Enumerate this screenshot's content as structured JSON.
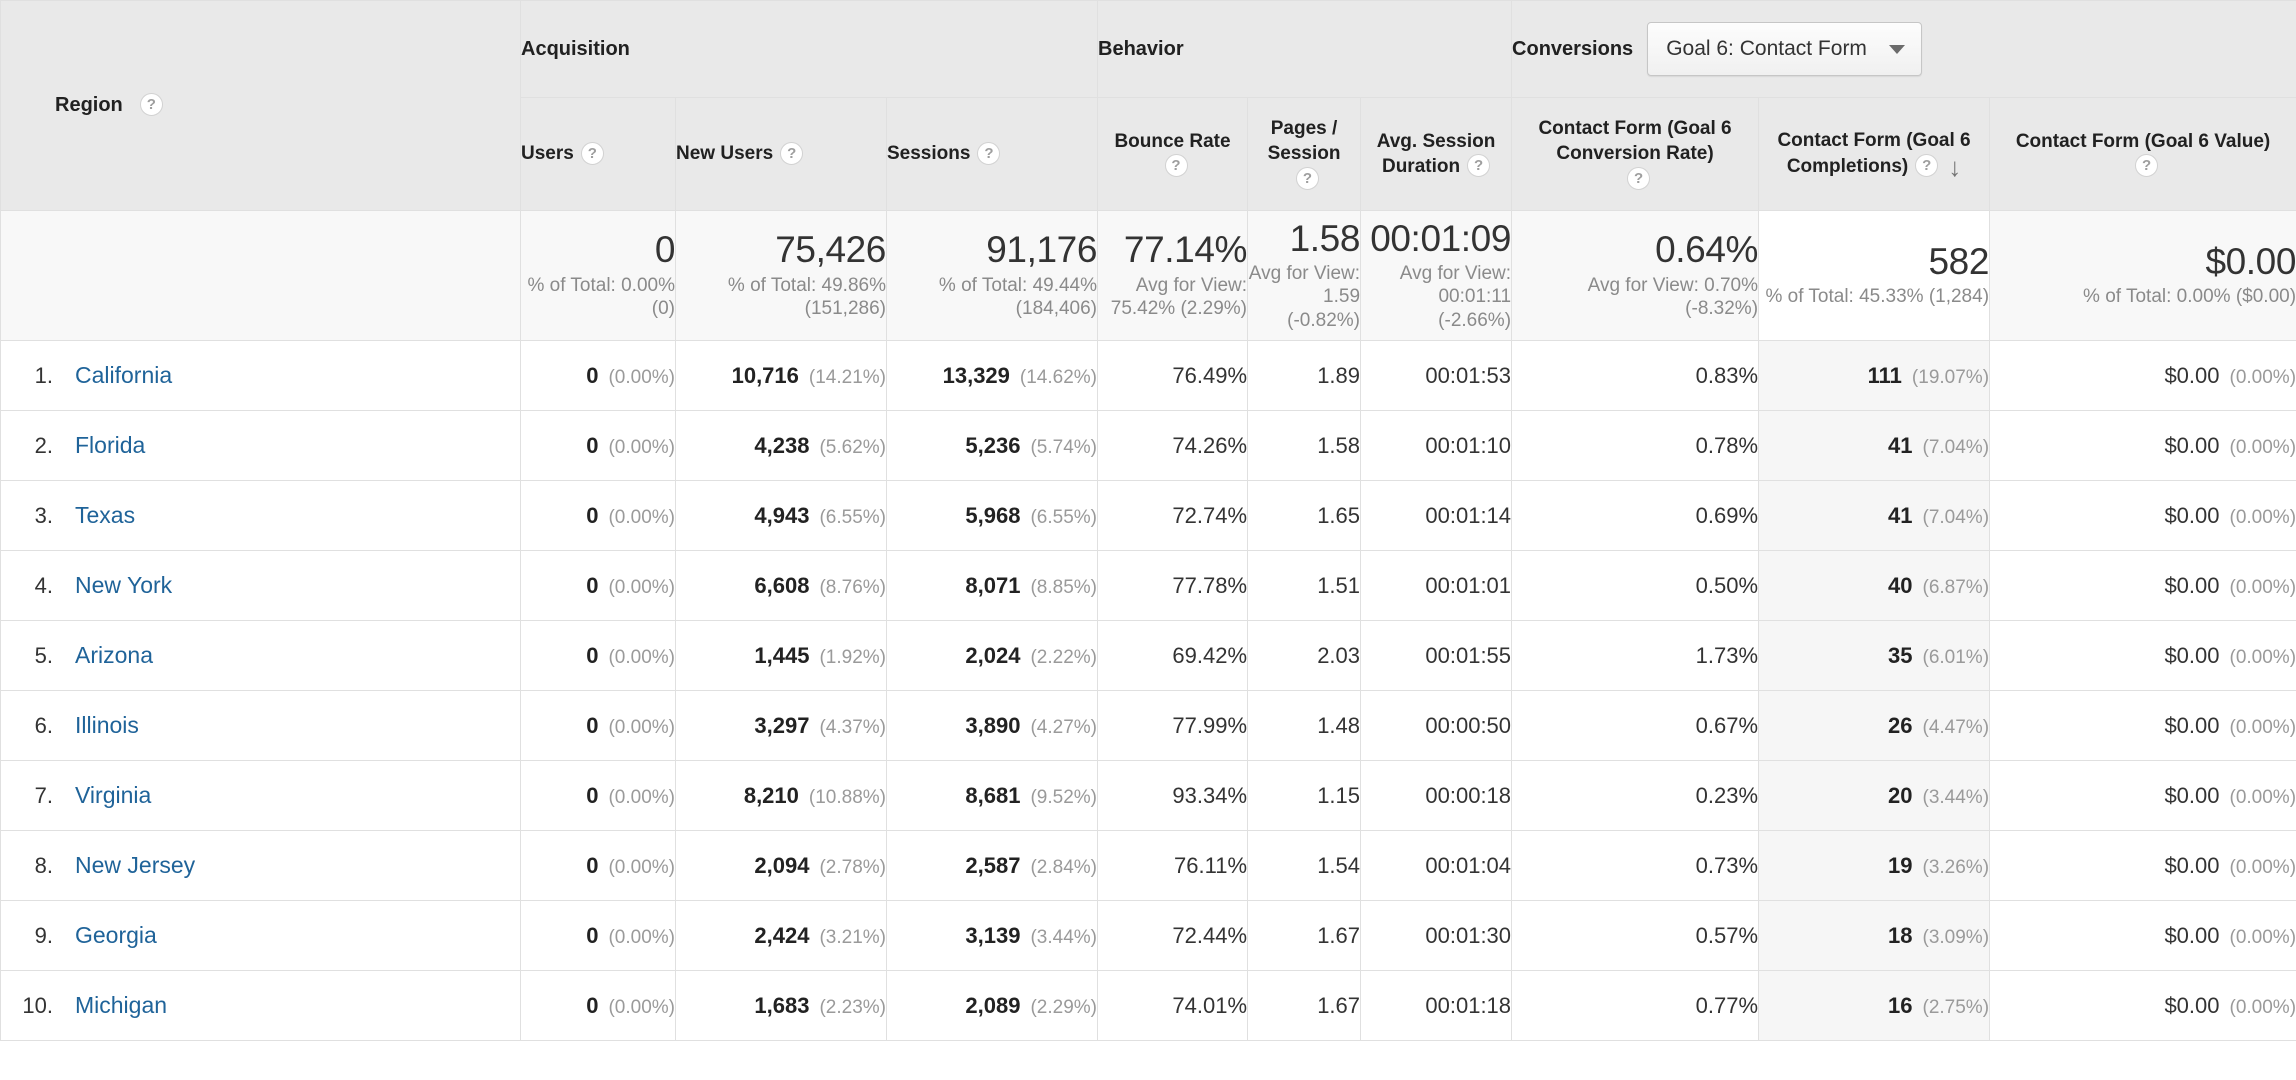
{
  "table": {
    "dimension_header": {
      "label": "Region",
      "help_icon": "help-icon"
    },
    "groups": [
      {
        "key": "acquisition",
        "label": "Acquisition"
      },
      {
        "key": "behavior",
        "label": "Behavior"
      },
      {
        "key": "conversions",
        "label": "Conversions"
      }
    ],
    "goal_selector": {
      "label": "Conversions",
      "value": "Goal 6: Contact Form",
      "caret_icon": "chevron-down-icon"
    },
    "columns": [
      {
        "key": "users",
        "label": "Users",
        "group": "acquisition",
        "align": "left",
        "sorted": false
      },
      {
        "key": "new_users",
        "label": "New Users",
        "group": "acquisition",
        "align": "left",
        "sorted": false
      },
      {
        "key": "sessions",
        "label": "Sessions",
        "group": "acquisition",
        "align": "left",
        "sorted": false
      },
      {
        "key": "bounce_rate",
        "label": "Bounce Rate",
        "group": "behavior",
        "align": "center",
        "sorted": false
      },
      {
        "key": "pages_session",
        "label": "Pages / Session",
        "group": "behavior",
        "align": "center",
        "sorted": false
      },
      {
        "key": "avg_duration",
        "label": "Avg. Session Duration",
        "group": "behavior",
        "align": "center",
        "sorted": false
      },
      {
        "key": "conv_rate",
        "label": "Contact Form (Goal 6 Conversion Rate)",
        "group": "conversions",
        "align": "center",
        "sorted": false
      },
      {
        "key": "completions",
        "label": "Contact Form (Goal 6 Completions)",
        "group": "conversions",
        "align": "center",
        "sorted": true,
        "sort_direction": "descending",
        "sort_icon": "arrow-down-icon"
      },
      {
        "key": "goal_value",
        "label": "Contact Form (Goal 6 Value)",
        "group": "conversions",
        "align": "center",
        "sorted": false
      }
    ],
    "summary": {
      "users": {
        "value": "0",
        "note": "% of Total: 0.00% (0)"
      },
      "new_users": {
        "value": "75,426",
        "note": "% of Total: 49.86% (151,286)"
      },
      "sessions": {
        "value": "91,176",
        "note": "% of Total: 49.44% (184,406)"
      },
      "bounce_rate": {
        "value": "77.14%",
        "note": "Avg for View: 75.42% (2.29%)"
      },
      "pages_session": {
        "value": "1.58",
        "note": "Avg for View: 1.59 (-0.82%)"
      },
      "avg_duration": {
        "value": "00:01:09",
        "note": "Avg for View: 00:01:11 (-2.66%)"
      },
      "conv_rate": {
        "value": "0.64%",
        "note": "Avg for View: 0.70% (-8.32%)"
      },
      "completions": {
        "value": "582",
        "note": "% of Total: 45.33% (1,284)"
      },
      "goal_value": {
        "value": "$0.00",
        "note": "% of Total: 0.00% ($0.00)"
      }
    },
    "rows": [
      {
        "rank": "1.",
        "region": "California",
        "users": "0",
        "users_pct": "(0.00%)",
        "new_users": "10,716",
        "new_users_pct": "(14.21%)",
        "sessions": "13,329",
        "sessions_pct": "(14.62%)",
        "bounce_rate": "76.49%",
        "pages_session": "1.89",
        "avg_duration": "00:01:53",
        "conv_rate": "0.83%",
        "completions": "111",
        "completions_pct": "(19.07%)",
        "goal_value": "$0.00",
        "goal_value_pct": "(0.00%)"
      },
      {
        "rank": "2.",
        "region": "Florida",
        "users": "0",
        "users_pct": "(0.00%)",
        "new_users": "4,238",
        "new_users_pct": "(5.62%)",
        "sessions": "5,236",
        "sessions_pct": "(5.74%)",
        "bounce_rate": "74.26%",
        "pages_session": "1.58",
        "avg_duration": "00:01:10",
        "conv_rate": "0.78%",
        "completions": "41",
        "completions_pct": "(7.04%)",
        "goal_value": "$0.00",
        "goal_value_pct": "(0.00%)"
      },
      {
        "rank": "3.",
        "region": "Texas",
        "users": "0",
        "users_pct": "(0.00%)",
        "new_users": "4,943",
        "new_users_pct": "(6.55%)",
        "sessions": "5,968",
        "sessions_pct": "(6.55%)",
        "bounce_rate": "72.74%",
        "pages_session": "1.65",
        "avg_duration": "00:01:14",
        "conv_rate": "0.69%",
        "completions": "41",
        "completions_pct": "(7.04%)",
        "goal_value": "$0.00",
        "goal_value_pct": "(0.00%)"
      },
      {
        "rank": "4.",
        "region": "New York",
        "users": "0",
        "users_pct": "(0.00%)",
        "new_users": "6,608",
        "new_users_pct": "(8.76%)",
        "sessions": "8,071",
        "sessions_pct": "(8.85%)",
        "bounce_rate": "77.78%",
        "pages_session": "1.51",
        "avg_duration": "00:01:01",
        "conv_rate": "0.50%",
        "completions": "40",
        "completions_pct": "(6.87%)",
        "goal_value": "$0.00",
        "goal_value_pct": "(0.00%)"
      },
      {
        "rank": "5.",
        "region": "Arizona",
        "users": "0",
        "users_pct": "(0.00%)",
        "new_users": "1,445",
        "new_users_pct": "(1.92%)",
        "sessions": "2,024",
        "sessions_pct": "(2.22%)",
        "bounce_rate": "69.42%",
        "pages_session": "2.03",
        "avg_duration": "00:01:55",
        "conv_rate": "1.73%",
        "completions": "35",
        "completions_pct": "(6.01%)",
        "goal_value": "$0.00",
        "goal_value_pct": "(0.00%)"
      },
      {
        "rank": "6.",
        "region": "Illinois",
        "users": "0",
        "users_pct": "(0.00%)",
        "new_users": "3,297",
        "new_users_pct": "(4.37%)",
        "sessions": "3,890",
        "sessions_pct": "(4.27%)",
        "bounce_rate": "77.99%",
        "pages_session": "1.48",
        "avg_duration": "00:00:50",
        "conv_rate": "0.67%",
        "completions": "26",
        "completions_pct": "(4.47%)",
        "goal_value": "$0.00",
        "goal_value_pct": "(0.00%)"
      },
      {
        "rank": "7.",
        "region": "Virginia",
        "users": "0",
        "users_pct": "(0.00%)",
        "new_users": "8,210",
        "new_users_pct": "(10.88%)",
        "sessions": "8,681",
        "sessions_pct": "(9.52%)",
        "bounce_rate": "93.34%",
        "pages_session": "1.15",
        "avg_duration": "00:00:18",
        "conv_rate": "0.23%",
        "completions": "20",
        "completions_pct": "(3.44%)",
        "goal_value": "$0.00",
        "goal_value_pct": "(0.00%)"
      },
      {
        "rank": "8.",
        "region": "New Jersey",
        "users": "0",
        "users_pct": "(0.00%)",
        "new_users": "2,094",
        "new_users_pct": "(2.78%)",
        "sessions": "2,587",
        "sessions_pct": "(2.84%)",
        "bounce_rate": "76.11%",
        "pages_session": "1.54",
        "avg_duration": "00:01:04",
        "conv_rate": "0.73%",
        "completions": "19",
        "completions_pct": "(3.26%)",
        "goal_value": "$0.00",
        "goal_value_pct": "(0.00%)"
      },
      {
        "rank": "9.",
        "region": "Georgia",
        "users": "0",
        "users_pct": "(0.00%)",
        "new_users": "2,424",
        "new_users_pct": "(3.21%)",
        "sessions": "3,139",
        "sessions_pct": "(3.44%)",
        "bounce_rate": "72.44%",
        "pages_session": "1.67",
        "avg_duration": "00:01:30",
        "conv_rate": "0.57%",
        "completions": "18",
        "completions_pct": "(3.09%)",
        "goal_value": "$0.00",
        "goal_value_pct": "(0.00%)"
      },
      {
        "rank": "10.",
        "region": "Michigan",
        "users": "0",
        "users_pct": "(0.00%)",
        "new_users": "1,683",
        "new_users_pct": "(2.23%)",
        "sessions": "2,089",
        "sessions_pct": "(2.29%)",
        "bounce_rate": "74.01%",
        "pages_session": "1.67",
        "avg_duration": "00:01:18",
        "conv_rate": "0.77%",
        "completions": "16",
        "completions_pct": "(2.75%)",
        "goal_value": "$0.00",
        "goal_value_pct": "(0.00%)"
      }
    ],
    "help_glyph": "?",
    "sort_glyph": "↓",
    "colors": {
      "link": "#1f6399",
      "header_bg": "#e9e9e9",
      "sorted_bg": "#f6f6f6"
    }
  }
}
